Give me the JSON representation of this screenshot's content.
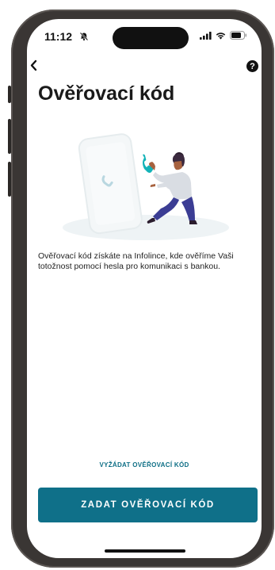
{
  "status_bar": {
    "time": "11:12"
  },
  "header": {
    "back_icon": "chevron-left-icon",
    "help_label": "?",
    "title": "Ověřovací kód"
  },
  "main": {
    "illustration": "person-holding-phone-illustration",
    "description": "Ověřovací kód získáte na Infolince, kde ověříme Vaši totožnost pomocí hesla pro komunikaci s bankou."
  },
  "actions": {
    "request_link": "VYŽÁDAT OVĚŘOVACÍ KÓD",
    "enter_button": "ZADAT OVĚŘOVACÍ KÓD"
  },
  "colors": {
    "accent": "#0f7089",
    "link": "#0d6e85"
  }
}
